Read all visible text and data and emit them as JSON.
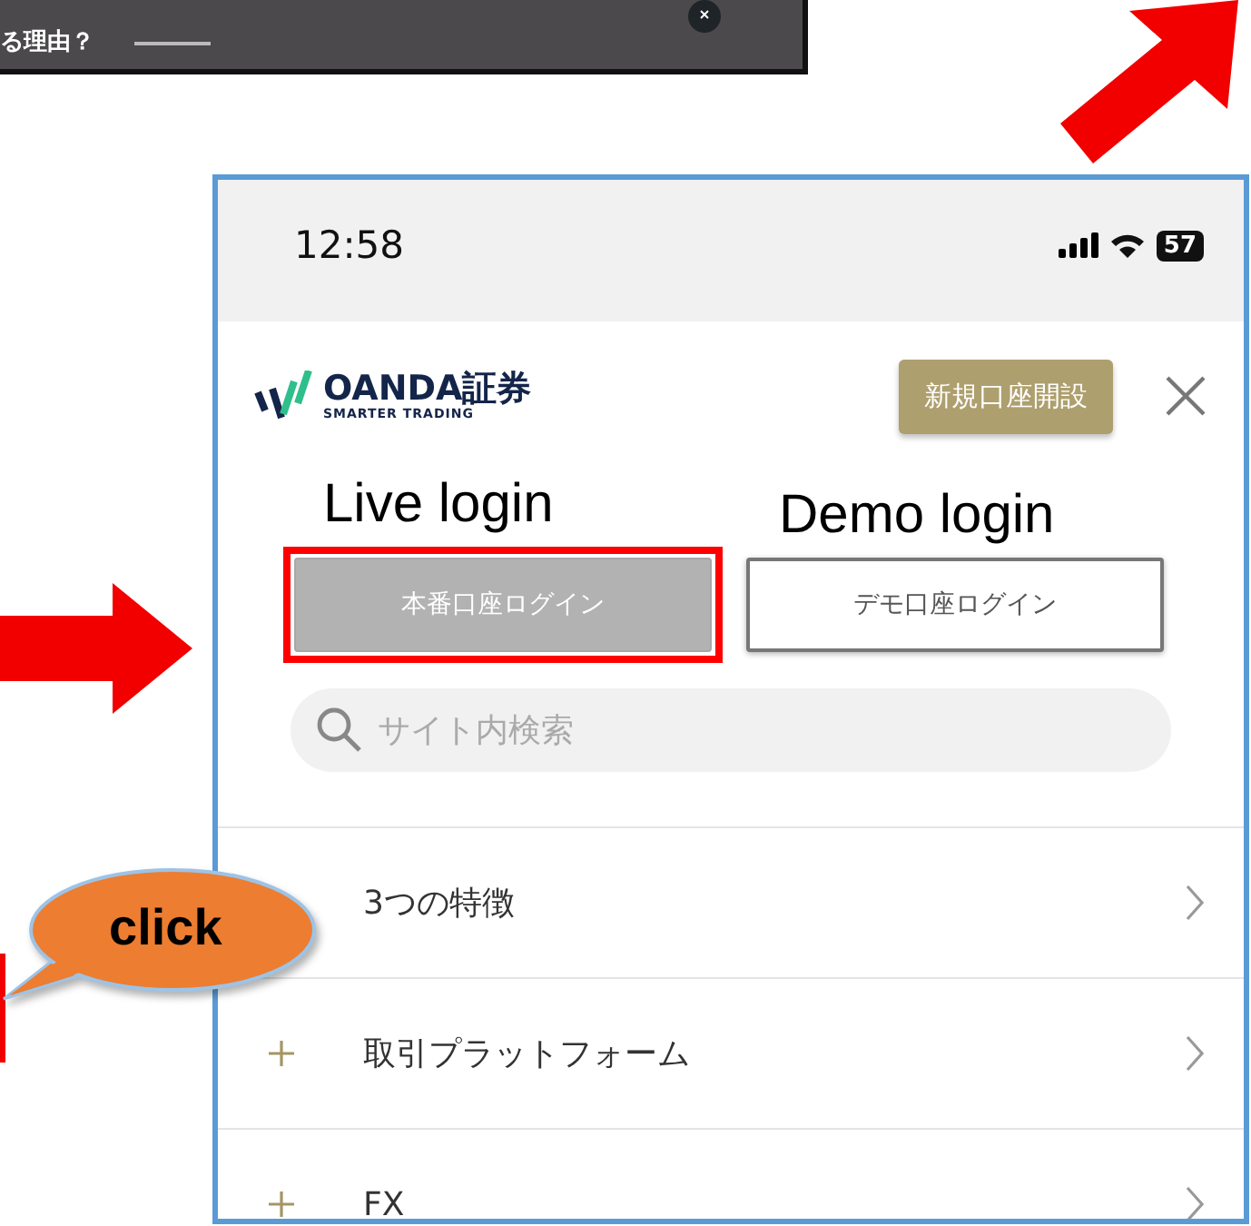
{
  "video_strip": {
    "caption": "る理由？"
  },
  "status_bar": {
    "time": "12:58",
    "battery": "57"
  },
  "header": {
    "logo": {
      "name": "OANDA",
      "suffix": "証券",
      "tagline": "SMARTER TRADING"
    },
    "signup_button": "新規口座開設"
  },
  "login_buttons": [
    {
      "label": "本番口座ログイン",
      "kind": "live",
      "highlighted": true,
      "annotation": "Live login"
    },
    {
      "label": "デモ口座ログイン",
      "kind": "demo",
      "highlighted": false,
      "annotation": "Demo login"
    }
  ],
  "search": {
    "placeholder": "サイト内検索"
  },
  "menu": [
    {
      "label": "3つの特徴",
      "expandable": false
    },
    {
      "label": "取引プラットフォーム",
      "expandable": true
    },
    {
      "label": "FX",
      "expandable": true
    }
  ],
  "callout": {
    "text": "click"
  }
}
